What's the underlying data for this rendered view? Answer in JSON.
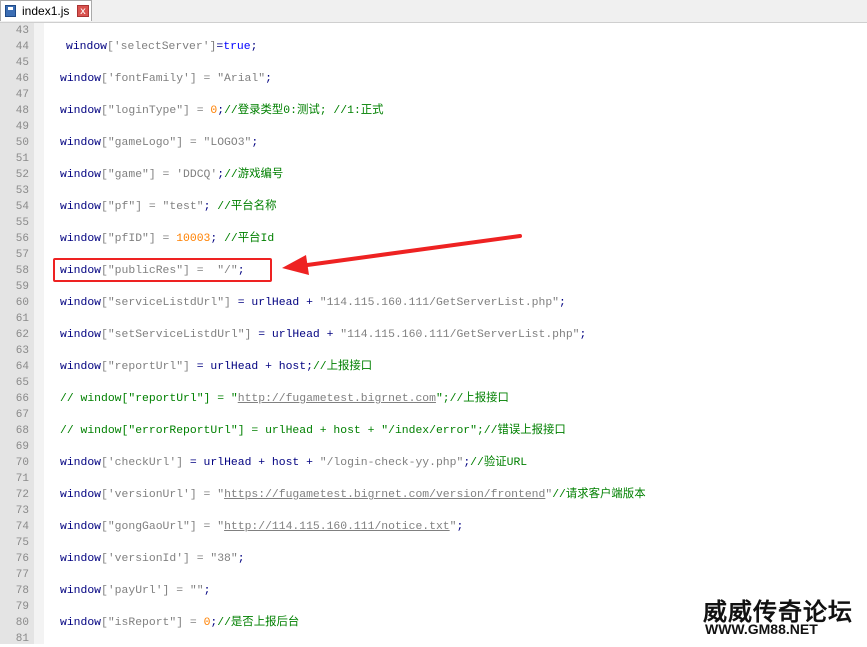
{
  "tab": {
    "title": "index1.js",
    "close": "x"
  },
  "editor": {
    "lines": [
      {
        "n": "43",
        "tokens": []
      },
      {
        "n": "44",
        "indent": true,
        "tokens": [
          [
            "kw",
            "window"
          ],
          [
            "str",
            "['selectServer']"
          ],
          [
            "kw",
            "="
          ],
          [
            "bool",
            "true"
          ],
          [
            "kw",
            ";"
          ]
        ]
      },
      {
        "n": "45",
        "tokens": []
      },
      {
        "n": "46",
        "tokens": [
          [
            "kw",
            "window"
          ],
          [
            "str",
            "['fontFamily'] = \"Arial\""
          ],
          [
            "kw",
            ";"
          ]
        ]
      },
      {
        "n": "47",
        "tokens": []
      },
      {
        "n": "48",
        "tokens": [
          [
            "kw",
            "window"
          ],
          [
            "str",
            "[\"loginType\"] = "
          ],
          [
            "num",
            "0"
          ],
          [
            "kw",
            ";"
          ],
          [
            "cm",
            "//登录类型0:测试; //1:正式"
          ]
        ]
      },
      {
        "n": "49",
        "tokens": []
      },
      {
        "n": "50",
        "tokens": [
          [
            "kw",
            "window"
          ],
          [
            "str",
            "[\"gameLogo\"] = \"LOGO3\""
          ],
          [
            "kw",
            ";"
          ]
        ]
      },
      {
        "n": "51",
        "tokens": []
      },
      {
        "n": "52",
        "tokens": [
          [
            "kw",
            "window"
          ],
          [
            "str",
            "[\"game\"] = 'DDCQ'"
          ],
          [
            "kw",
            ";"
          ],
          [
            "cm",
            "//游戏编号"
          ]
        ]
      },
      {
        "n": "53",
        "tokens": []
      },
      {
        "n": "54",
        "tokens": [
          [
            "kw",
            "window"
          ],
          [
            "str",
            "[\"pf\"] = \"test\""
          ],
          [
            "kw",
            "; "
          ],
          [
            "cm",
            "//平台名称"
          ]
        ]
      },
      {
        "n": "55",
        "tokens": []
      },
      {
        "n": "56",
        "tokens": [
          [
            "kw",
            "window"
          ],
          [
            "str",
            "[\"pfID\"] = "
          ],
          [
            "num",
            "10003"
          ],
          [
            "kw",
            "; "
          ],
          [
            "cm",
            "//平台Id"
          ]
        ]
      },
      {
        "n": "57",
        "tokens": []
      },
      {
        "n": "58",
        "tokens": [
          [
            "kw",
            "window"
          ],
          [
            "str",
            "[\"publicRes\"] =  \"/\""
          ],
          [
            "kw",
            ";"
          ]
        ]
      },
      {
        "n": "59",
        "tokens": []
      },
      {
        "n": "60",
        "tokens": [
          [
            "kw",
            "window"
          ],
          [
            "str",
            "[\"serviceListdUrl\"] "
          ],
          [
            "kw",
            "= urlHead + "
          ],
          [
            "str",
            "\"114.115.160.111/GetServerList.php\""
          ],
          [
            "kw",
            ";"
          ]
        ]
      },
      {
        "n": "61",
        "tokens": []
      },
      {
        "n": "62",
        "tokens": [
          [
            "kw",
            "window"
          ],
          [
            "str",
            "[\"setServiceListdUrl\"] "
          ],
          [
            "kw",
            "= urlHead + "
          ],
          [
            "str",
            "\"114.115.160.111/GetServerList.php\""
          ],
          [
            "kw",
            ";"
          ]
        ]
      },
      {
        "n": "63",
        "tokens": []
      },
      {
        "n": "64",
        "tokens": [
          [
            "kw",
            "window"
          ],
          [
            "str",
            "[\"reportUrl\"] "
          ],
          [
            "kw",
            "= urlHead + host;"
          ],
          [
            "cm",
            "//上报接口"
          ]
        ]
      },
      {
        "n": "65",
        "tokens": []
      },
      {
        "n": "66",
        "tokens": [
          [
            "cm",
            "// window[\"reportUrl\"] = \""
          ],
          [
            "url",
            "http://fugametest.bigrnet.com"
          ],
          [
            "cm",
            "\";//上报接口"
          ]
        ]
      },
      {
        "n": "67",
        "tokens": []
      },
      {
        "n": "68",
        "tokens": [
          [
            "cm",
            "// window[\"errorReportUrl\"] = urlHead + host + \"/index/error\";//错误上报接口"
          ]
        ]
      },
      {
        "n": "69",
        "tokens": []
      },
      {
        "n": "70",
        "tokens": [
          [
            "kw",
            "window"
          ],
          [
            "str",
            "['checkUrl'] "
          ],
          [
            "kw",
            "= urlHead + host + "
          ],
          [
            "str",
            "\"/login-check-yy.php\""
          ],
          [
            "kw",
            ";"
          ],
          [
            "cm",
            "//验证URL"
          ]
        ]
      },
      {
        "n": "71",
        "tokens": []
      },
      {
        "n": "72",
        "tokens": [
          [
            "kw",
            "window"
          ],
          [
            "str",
            "['versionUrl'] = \""
          ],
          [
            "url",
            "https://fugametest.bigrnet.com/version/frontend"
          ],
          [
            "str",
            "\""
          ],
          [
            "cm",
            "//请求客户端版本"
          ]
        ]
      },
      {
        "n": "73",
        "tokens": []
      },
      {
        "n": "74",
        "tokens": [
          [
            "kw",
            "window"
          ],
          [
            "str",
            "[\"gongGaoUrl\"] = \""
          ],
          [
            "url",
            "http://114.115.160.111/notice.txt"
          ],
          [
            "str",
            "\""
          ],
          [
            "kw",
            ";"
          ]
        ]
      },
      {
        "n": "75",
        "tokens": []
      },
      {
        "n": "76",
        "tokens": [
          [
            "kw",
            "window"
          ],
          [
            "str",
            "['versionId'] = \"38\""
          ],
          [
            "kw",
            ";"
          ]
        ]
      },
      {
        "n": "77",
        "tokens": []
      },
      {
        "n": "78",
        "tokens": [
          [
            "kw",
            "window"
          ],
          [
            "str",
            "['payUrl'] = \"\""
          ],
          [
            "kw",
            ";"
          ]
        ]
      },
      {
        "n": "79",
        "tokens": []
      },
      {
        "n": "80",
        "tokens": [
          [
            "kw",
            "window"
          ],
          [
            "str",
            "[\"isReport\"] = "
          ],
          [
            "num",
            "0"
          ],
          [
            "kw",
            ";"
          ],
          [
            "cm",
            "//是否上报后台"
          ]
        ]
      },
      {
        "n": "81",
        "tokens": []
      }
    ]
  },
  "watermark": {
    "title": "威威传奇论坛",
    "url": "WWW.GM88.NET"
  },
  "colors": {
    "highlight": "#ee2222",
    "keyword": "#000080",
    "string": "#808080",
    "number": "#ff8000",
    "comment": "#008000"
  }
}
